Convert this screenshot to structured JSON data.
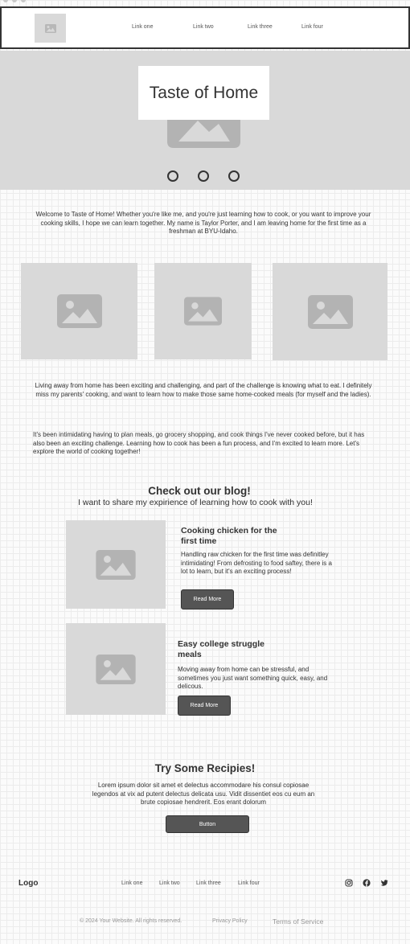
{
  "header": {
    "nav": [
      "Link one",
      "Link two",
      "Link three",
      "Link four"
    ]
  },
  "hero": {
    "title": "Taste of Home",
    "carousel_slides": 3
  },
  "intro": {
    "welcome": "Welcome to Taste of Home! Whether you're like me, and you're just learning how to cook, or you want to improve your cooking skills, I hope we can learn together. My name is Taylor Porter, and I am leaving home for the first time as a freshman at BYU-Idaho.",
    "living_away": "Living away from home has been exciting and challenging, and part of the challenge is knowing what to eat. I definitely miss my parents' cooking, and want to learn how to make those same home-cooked meals (for myself and the ladies).",
    "intimidating": "It's been intimidating having to plan meals, go grocery shopping, and cook things I've never cooked before, but it has also been an exciting challenge. Learning how to cook has been a fun process, and I'm excited to learn more. Let's explore the world of cooking together!"
  },
  "blog": {
    "title": "Check out our blog!",
    "subtitle": "I want to share my expirience of learning how to cook with you!",
    "posts": [
      {
        "title": "Cooking chicken for the first time",
        "text": "Handling raw chicken for the first time was definitley intimidating! From defrosting to food saftey, there is a lot to learn, but it's an exciting process!",
        "button": "Read More"
      },
      {
        "title": "Easy college struggle meals",
        "text": "Moving away from home can be stressful, and sometimes you just want something quick, easy, and delicous.",
        "button": "Read More"
      }
    ]
  },
  "recipes": {
    "title": "Try Some Recipies!",
    "text": "Lorem ipsum dolor sit amet et delectus accommodare his consul copiosae legendos at vix ad putent delectus delicata usu. Vidit dissentiet eos cu eum an brute copiosae hendrerit. Eos erant dolorum",
    "button": "Button"
  },
  "footer": {
    "logo": "Logo",
    "links": [
      "Link one",
      "Link two",
      "Link three",
      "Link four"
    ],
    "social_icons": [
      "instagram-icon",
      "facebook-icon",
      "twitter-icon"
    ],
    "copyright": "© 2024 Your Website. All rights reserved.",
    "privacy": "Privacy Policy",
    "terms": "Terms of Service"
  },
  "colors": {
    "placeholder_gray": "#d9d9d9",
    "dark_button": "#555555",
    "text": "#333333"
  }
}
